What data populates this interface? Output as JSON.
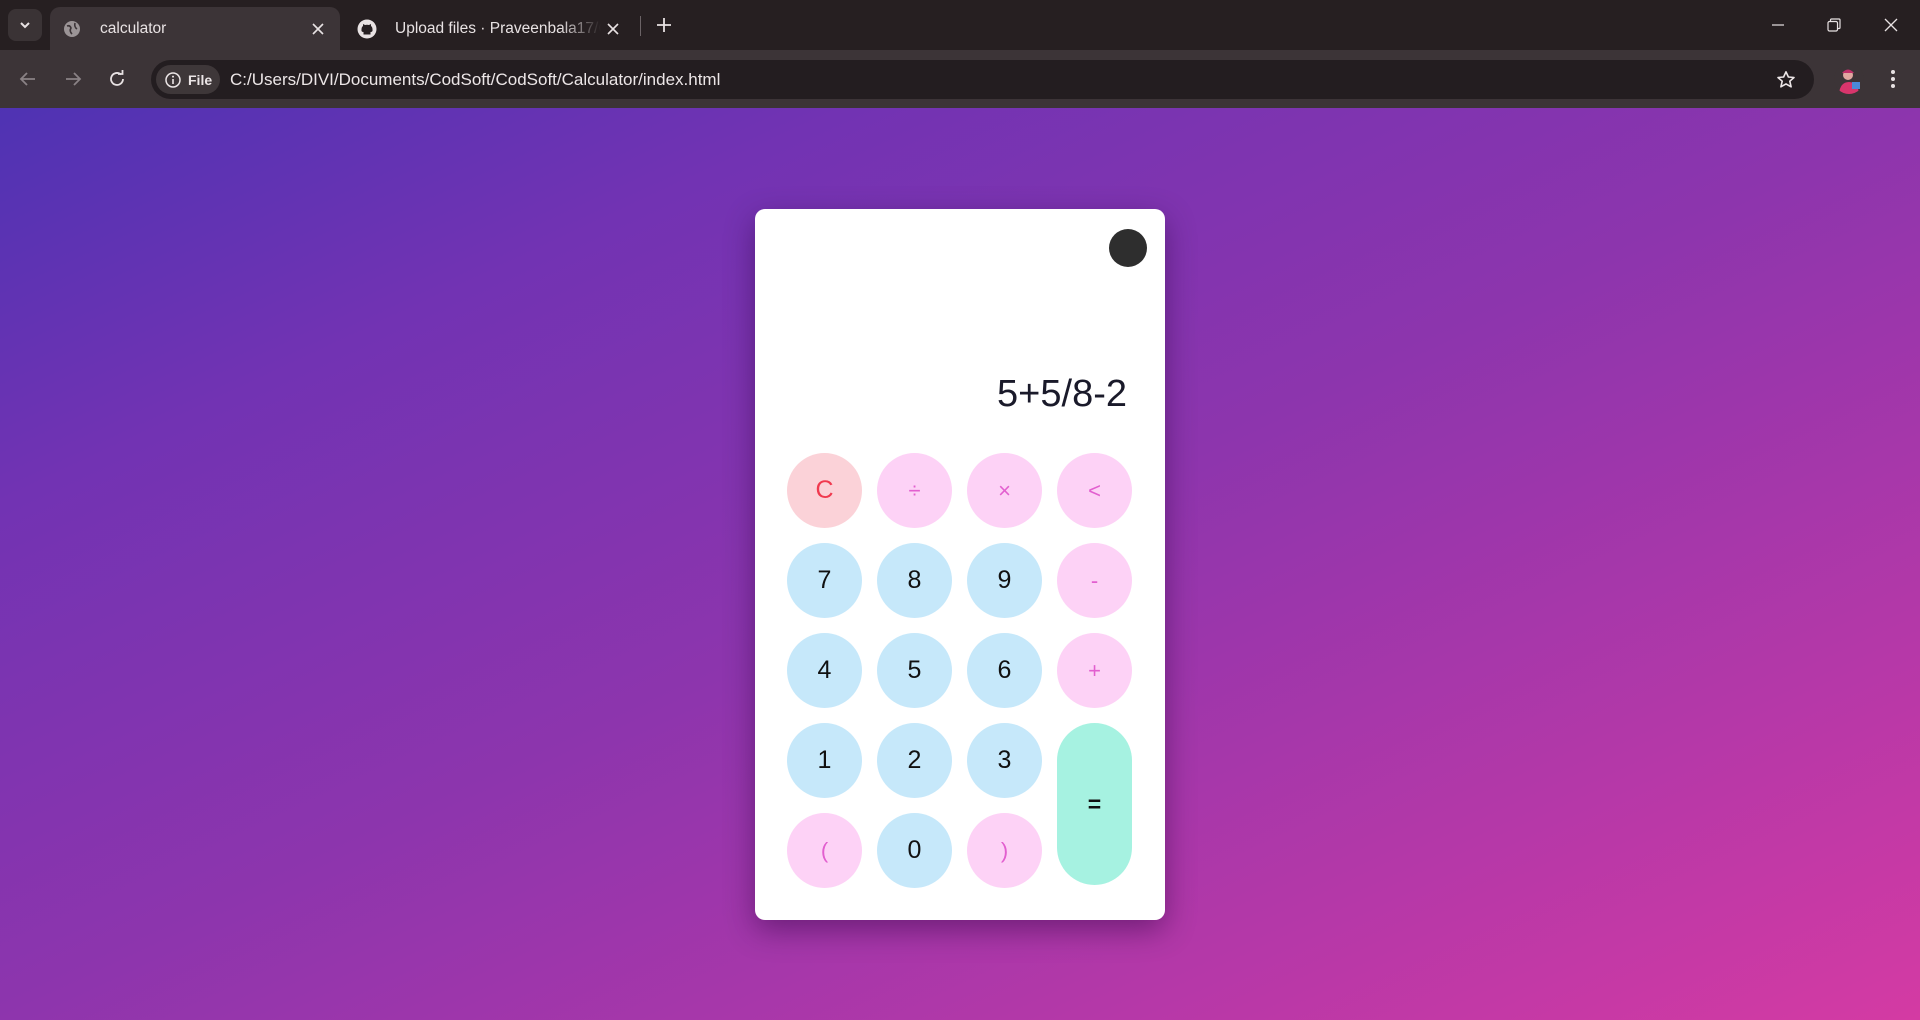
{
  "browser": {
    "tabs": [
      {
        "title": "calculator",
        "icon": "globe-icon",
        "active": true
      },
      {
        "title": "Upload files · Praveenbala17/CodSoft",
        "icon": "github-icon",
        "active": false
      }
    ],
    "address": {
      "scheme_chip": "File",
      "url": "C:/Users/DIVI/Documents/CodSoft/CodSoft/Calculator/index.html"
    }
  },
  "calculator": {
    "display": "5+5/8-2",
    "keys": {
      "clear": "C",
      "divide": "÷",
      "multiply": "×",
      "backspace": "<",
      "seven": "7",
      "eight": "8",
      "nine": "9",
      "minus": "-",
      "four": "4",
      "five": "5",
      "six": "6",
      "plus": "+",
      "one": "1",
      "two": "2",
      "three": "3",
      "equals": "=",
      "open_paren": "(",
      "zero": "0",
      "close_paren": ")"
    },
    "colors": {
      "number_key": "#c6e8fa",
      "operator_key": "#fdd2f6",
      "operator_text": "#e25fcf",
      "clear_key": "#fbd2d8",
      "clear_text": "#f03a4f",
      "equals_key": "#a6f2e1"
    }
  }
}
